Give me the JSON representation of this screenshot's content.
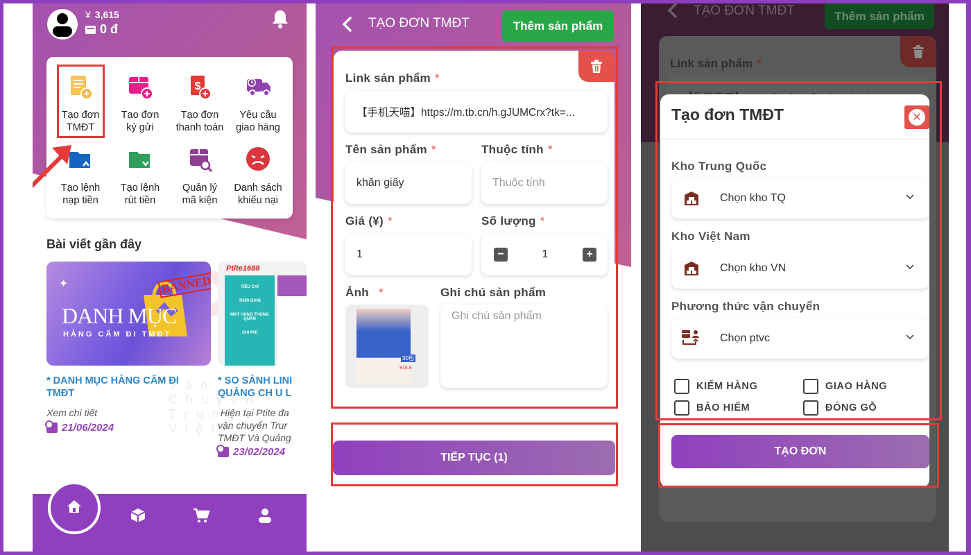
{
  "home": {
    "balance_cny_symbol": "¥",
    "balance_cny": "3,615",
    "balance_vnd": "0 đ",
    "menu": [
      {
        "label_l1": "Tạo đơn",
        "label_l2": "TMĐT",
        "icon": "order-plus-icon",
        "color": "#f5b942"
      },
      {
        "label_l1": "Tạo đơn",
        "label_l2": "ký gửi",
        "icon": "box-plus-icon",
        "color": "#e91e8c"
      },
      {
        "label_l1": "Tạo đơn",
        "label_l2": "thanh toán",
        "icon": "payment-plus-icon",
        "color": "#e53935"
      },
      {
        "label_l1": "Yêu cầu",
        "label_l2": "giao hàng",
        "icon": "delivery-truck-icon",
        "color": "#8e44ad"
      },
      {
        "label_l1": "Tạo lệnh",
        "label_l2": "nạp tiền",
        "icon": "wallet-deposit-icon",
        "color": "#1565c0"
      },
      {
        "label_l1": "Tạo lệnh",
        "label_l2": "rút tiền",
        "icon": "wallet-withdraw-icon",
        "color": "#2e9e5b"
      },
      {
        "label_l1": "Quản lý",
        "label_l2": "mã kiện",
        "icon": "package-search-icon",
        "color": "#8e3f8f"
      },
      {
        "label_l1": "Danh sách",
        "label_l2": "khiếu nại",
        "icon": "sad-face-icon",
        "color": "#d9363e"
      }
    ],
    "recent_title": "Bài viết gần đây",
    "articles": [
      {
        "image_title": "DANH MỤC",
        "image_subtitle": "HÀNG CẤM ĐI TMĐT",
        "image_stamp": "BANNED",
        "title_l1": "* DANH MỤC HÀNG CẤM ĐI",
        "title_l2": "TMĐT",
        "desc": "Xem chi tiết",
        "date": "21/06/2024"
      },
      {
        "image_logo": "Ptite1688",
        "image_col1": "TIÊU CHÍ",
        "image_col1_r2": "THỜI GIAN",
        "image_col1_r3": "MẶT HÀNG THÔNG QUAN",
        "image_col1_r4": "CHI PHÍ",
        "title_l1": "* SO SÁNH LINI",
        "title_l2": "QUẢNG CH U L",
        "desc_l1": " Hiện tại Ptite đa",
        "desc_l2": "vận chuyển Trur",
        "desc_l3": "TMĐT Và Quảng",
        "date": "23/02/2024"
      }
    ],
    "watermark": "Ptite",
    "watermark_sub": "Vận Chuyển Trung Việt",
    "nav": [
      "home-icon",
      "box-icon",
      "cart-icon",
      "user-icon"
    ]
  },
  "form": {
    "header_title": "TẠO ĐƠN TMĐT",
    "add_product_label": "Thêm sản phẩm",
    "link_label": "Link sản phẩm",
    "link_value": "【手机天喵】https://m.tb.cn/h.gJUMCrx?tk=...",
    "name_label": "Tên sản phẩm",
    "name_value": "khăn giấy",
    "attr_label": "Thuộc tính",
    "attr_placeholder": "Thuộc tính",
    "price_label": "Giá (¥)",
    "price_value": "1",
    "qty_label": "Số lượng",
    "qty_value": "1",
    "image_label": "Ảnh",
    "image_price": "¥18.9",
    "image_badge": "30包",
    "note_label": "Ghi chú sản phẩm",
    "note_placeholder": "Ghi chú sản phẩm",
    "required_mark": "*",
    "continue_label": "TIẾP TỤC (1)"
  },
  "modal": {
    "bg_link_partial": "【手机天喵】https://m.tb.cn/h.gJUMCrx?tk=",
    "title": "Tạo đơn TMĐT",
    "cn_warehouse_label": "Kho Trung Quốc",
    "cn_warehouse_value": "Chọn kho TQ",
    "vn_warehouse_label": "Kho Việt Nam",
    "vn_warehouse_value": "Chọn kho VN",
    "shipping_label": "Phương thức vận chuyển",
    "shipping_value": "Chọn ptvc",
    "options": [
      {
        "label": "KIỂM HÀNG",
        "checked": false
      },
      {
        "label": "GIAO HÀNG",
        "checked": false
      },
      {
        "label": "BẢO HIỂM",
        "checked": false
      },
      {
        "label": "ĐÓNG GỖ",
        "checked": false
      }
    ],
    "create_label": "TẠO ĐƠN"
  },
  "colors": {
    "brand_purple": "#9040be",
    "highlight_red": "#e43a3a",
    "add_green": "#27a745",
    "delete_red": "#e4514b",
    "link_blue": "#2e86c8",
    "warehouse_brown": "#7a2f22"
  }
}
